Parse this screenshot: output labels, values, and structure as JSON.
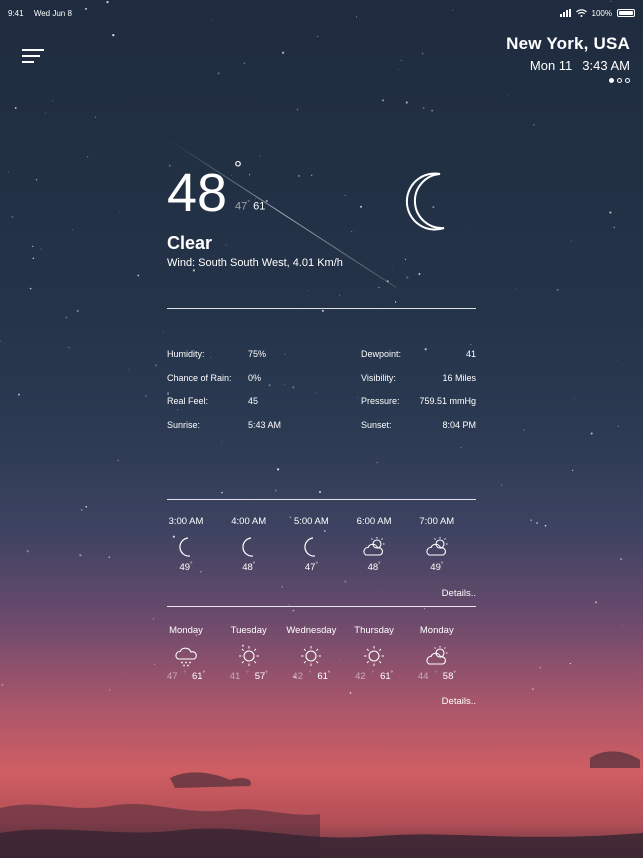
{
  "status_bar": {
    "time": "9:41",
    "date": "Wed Jun 8",
    "battery": "100%"
  },
  "location": {
    "city": "New York, USA",
    "day": "Mon 11",
    "time": "3:43 AM",
    "pages": 3,
    "active_page": 1
  },
  "current": {
    "temperature": "48",
    "degree": "°",
    "low": "47",
    "high": "61",
    "condition": "Clear",
    "wind": "Wind: South South West, 4.01 Km/h",
    "icon": "crescent-moon-icon"
  },
  "details": [
    {
      "label_left": "Humidity:",
      "value_left": "75%",
      "label_right": "Dewpoint:",
      "value_right": "41"
    },
    {
      "label_left": "Chance of Rain:",
      "value_left": "0%",
      "label_right": "Visibility:",
      "value_right": "16 Miles"
    },
    {
      "label_left": "Real Feel:",
      "value_left": "45",
      "label_right": "Pressure:",
      "value_right": "759.51 mmHg"
    },
    {
      "label_left": "Sunrise:",
      "value_left": "5:43 AM",
      "label_right": "Sunset:",
      "value_right": "8:04 PM"
    }
  ],
  "hourly": [
    {
      "time": "3:00 AM",
      "icon": "moon-icon",
      "temp": "49"
    },
    {
      "time": "4:00 AM",
      "icon": "moon-icon",
      "temp": "48"
    },
    {
      "time": "5:00 AM",
      "icon": "moon-icon",
      "temp": "47"
    },
    {
      "time": "6:00 AM",
      "icon": "partly-cloudy-icon",
      "temp": "48"
    },
    {
      "time": "7:00 AM",
      "icon": "partly-cloudy-icon",
      "temp": "49"
    }
  ],
  "hourly_details_label": "Details..",
  "daily": [
    {
      "day": "Monday",
      "icon": "rain-cloud-icon",
      "low": "47",
      "high": "61"
    },
    {
      "day": "Tuesday",
      "icon": "sun-icon",
      "low": "41",
      "high": "57"
    },
    {
      "day": "Wednesday",
      "icon": "sun-icon",
      "low": "42",
      "high": "61"
    },
    {
      "day": "Thursday",
      "icon": "sun-icon",
      "low": "42",
      "high": "61"
    },
    {
      "day": "Monday",
      "icon": "partly-cloudy-icon",
      "low": "44",
      "high": "58"
    }
  ],
  "daily_details_label": "Details..",
  "colors": {
    "sky_top": "#1f2c3f",
    "horizon": "#cf5e62"
  }
}
